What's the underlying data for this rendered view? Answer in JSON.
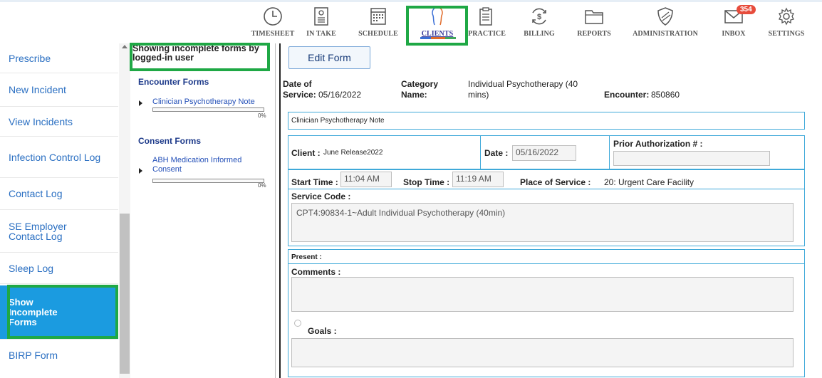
{
  "nav": {
    "items": [
      {
        "label": "TIMESHEET",
        "icon": "clock-icon"
      },
      {
        "label": "IN TAKE",
        "icon": "intake-form-icon"
      },
      {
        "label": "SCHEDULE",
        "icon": "calendar-icon"
      },
      {
        "label": "CLIENTS",
        "icon": "clients-head-icon"
      },
      {
        "label": "PRACTICE",
        "icon": "clipboard-icon"
      },
      {
        "label": "BILLING",
        "icon": "dollar-icon"
      },
      {
        "label": "REPORTS",
        "icon": "folder-icon"
      },
      {
        "label": "ADMINISTRATION",
        "icon": "shield-icon"
      },
      {
        "label": "INBOX",
        "icon": "envelope-icon"
      },
      {
        "label": "SETTINGS",
        "icon": "gear-icon"
      }
    ],
    "inbox_badge": "354",
    "active": "CLIENTS"
  },
  "sidebar": {
    "items": [
      {
        "label": "Prescribe"
      },
      {
        "label": "New Incident"
      },
      {
        "label": "View Incidents"
      },
      {
        "label": "Infection Control Log"
      },
      {
        "label": "Contact Log"
      },
      {
        "label": "SE Employer Contact Log"
      },
      {
        "label": "Sleep Log"
      },
      {
        "label": "Show Incomplete Forms"
      },
      {
        "label": "BIRP Form"
      }
    ],
    "active": "Show Incomplete Forms"
  },
  "forms_panel": {
    "title": "Showing incomplete forms by logged-in user",
    "encounter_title": "Encounter Forms",
    "encounter_forms": [
      {
        "name": "Clinician Psychotherapy Note",
        "progress": "0%"
      }
    ],
    "consent_title": "Consent Forms",
    "consent_forms": [
      {
        "name": "ABH Medication Informed Consent",
        "progress": "0%"
      }
    ]
  },
  "form": {
    "edit_button": "Edit Form",
    "date_of_service_label": "Date of Service:",
    "date_of_service_value": "05/16/2022",
    "category_label": "Category Name:",
    "category_value": "Individual Psychotherapy (40 mins)",
    "encounter_label": "Encounter:",
    "encounter_value": "850860",
    "note_title": "Clinician Psychotherapy Note",
    "client_label": "Client :",
    "client_value": "June Release2022",
    "date_label": "Date :",
    "date_value": "05/16/2022",
    "prior_auth_label": "Prior Authorization # :",
    "prior_auth_value": "",
    "start_time_label": "Start Time :",
    "start_time_value": "11:04 AM",
    "stop_time_label": "Stop Time :",
    "stop_time_value": "11:19 AM",
    "place_of_service_label": "Place of Service :",
    "place_of_service_value": "20: Urgent Care Facility",
    "service_code_label": "Service Code :",
    "service_code_value": "CPT4:90834-1~Adult Individual Psychotherapy (40min)",
    "present_label": "Present :",
    "comments_label": "Comments :",
    "comments_value": "",
    "goals_label": "Goals :",
    "goals_value": ""
  },
  "colors": {
    "highlight": "#1fa845",
    "active_sidebar": "#1b9be0",
    "link": "#2a6fc2",
    "field_border": "#3fa9d9",
    "badge": "#e74c3c"
  }
}
